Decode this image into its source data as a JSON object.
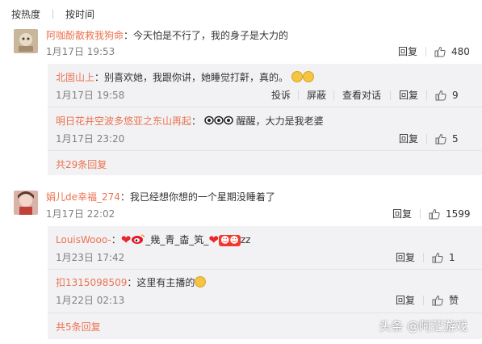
{
  "sort": {
    "hot_label": "按热度",
    "time_label": "按时间"
  },
  "comments": [
    {
      "user": "阿咖酚散救我狗命",
      "text": "：今天怕是不行了，我的身子是大力的",
      "time": "1月17日 19:53",
      "reply_label": "回复",
      "likes": "480",
      "replies": [
        {
          "user": "北固山上",
          "text": "：别喜欢她，我跟你讲，她睡觉打鼾，真的。",
          "time": "1月17日 19:58",
          "actions": [
            "投诉",
            "屏蔽",
            "查看对话",
            "回复"
          ],
          "likes": "9"
        },
        {
          "user": "明日花井空波多悠亚之东山再起",
          "text_before": "：",
          "text": " 醒醒，大力是我老婆",
          "time": "1月17日 23:20",
          "reply_label": "回复",
          "likes": "5"
        }
      ],
      "more_label": "共29条回复"
    },
    {
      "user": "娟儿de幸福_274",
      "text": "：我已经想你想的一个星期没睡着了",
      "time": "1月17日 22:02",
      "reply_label": "回复",
      "likes": "1599",
      "replies": [
        {
          "user": "LouisWooo-",
          "text_before": "：",
          "text_mid": "_幾_青_楍_笂_",
          "text_after": "zz",
          "time": "1月23日 17:42",
          "reply_label": "回复",
          "likes": "1"
        },
        {
          "user": "扣1315098509",
          "text": "：这里有主播的",
          "time": "1月22日 02:13",
          "reply_label": "回复",
          "likes": "赞"
        }
      ],
      "more_label": "共5条回复"
    }
  ],
  "watermark": "头条 @阿茫游戏",
  "colors": {
    "username": "#eb7350",
    "reply_bg": "#f2f2f5",
    "time": "#808080"
  },
  "icons": [
    "thumbs-up-icon",
    "smile-emoji-icon",
    "heart-icon",
    "weibo-logo-icon"
  ]
}
